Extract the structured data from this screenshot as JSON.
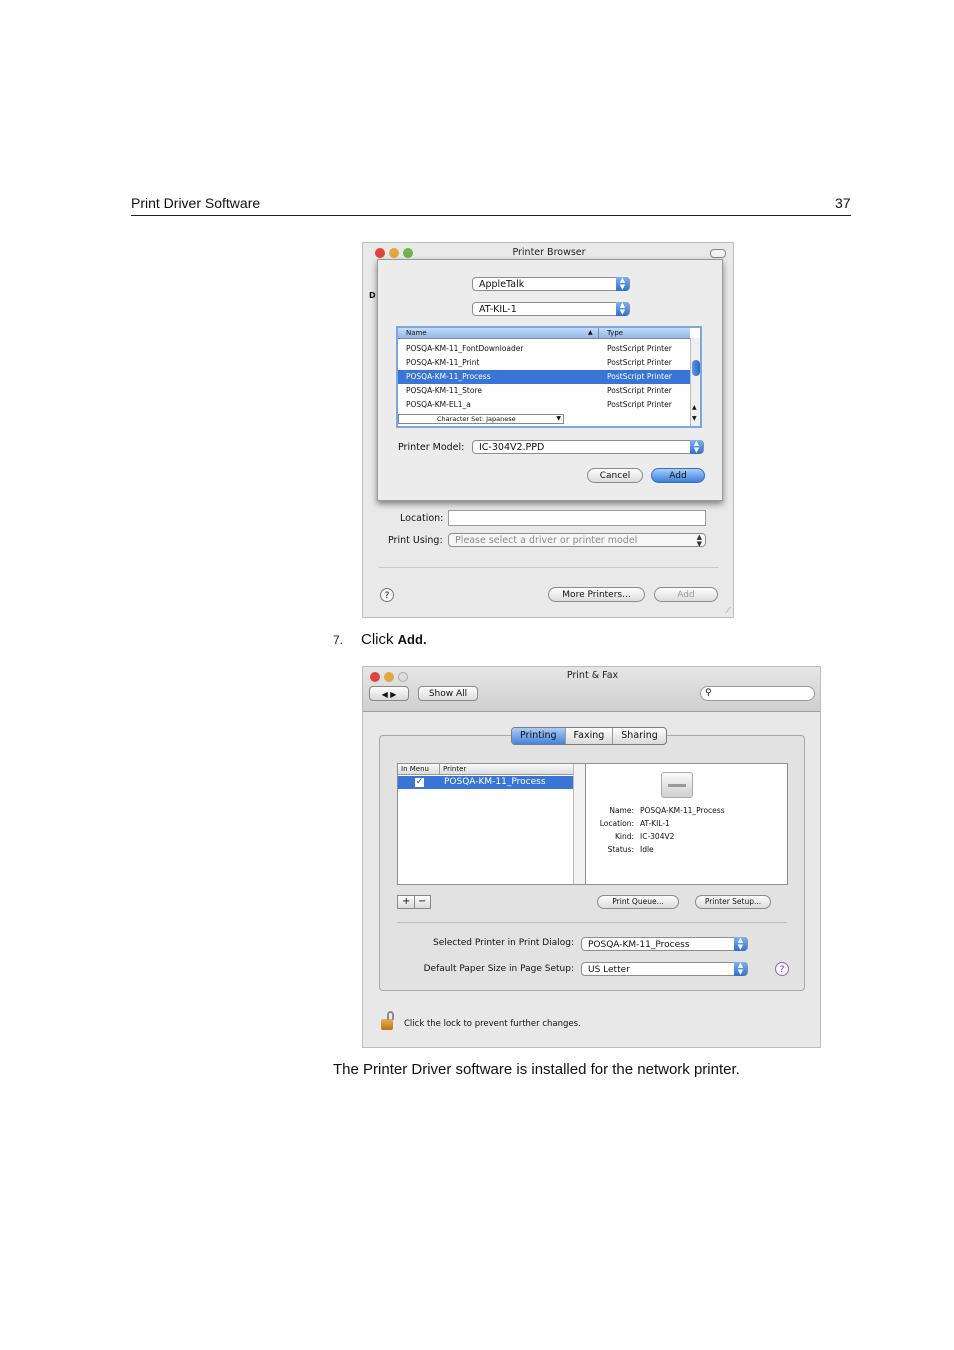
{
  "header": {
    "title": "Print Driver Software",
    "page_number": "37"
  },
  "printer_browser": {
    "window_title": "Printer Browser",
    "connection": "AppleTalk",
    "zone": "AT-KIL-1",
    "columns": {
      "name": "Name",
      "type": "Type"
    },
    "rows": [
      {
        "name": "POSQA-KM-11_FontDownloader",
        "type": "PostScript Printer",
        "selected": false
      },
      {
        "name": "POSQA-KM-11_Print",
        "type": "PostScript Printer",
        "selected": false
      },
      {
        "name": "POSQA-KM-11_Process",
        "type": "PostScript Printer",
        "selected": true
      },
      {
        "name": "POSQA-KM-11_Store",
        "type": "PostScript Printer",
        "selected": false
      },
      {
        "name": "POSQA-KM-EL1_a",
        "type": "PostScript Printer",
        "selected": false
      }
    ],
    "charset": "Character Set: Japanese",
    "printer_model_label": "Printer Model:",
    "printer_model_value": "IC-304V2.PPD",
    "cancel_label": "Cancel",
    "add_label": "Add",
    "side_letter": "D",
    "location_label": "Location:",
    "print_using_label": "Print Using:",
    "print_using_value": "Please select a driver or printer model",
    "more_printers_label": "More Printers...",
    "add_disabled_label": "Add",
    "help_glyph": "?"
  },
  "step": {
    "number": "7.",
    "text": "Click",
    "bold": "Add."
  },
  "print_fax": {
    "window_title": "Print & Fax",
    "show_all_label": "Show All",
    "tabs": [
      "Printing",
      "Faxing",
      "Sharing"
    ],
    "active_tab": "Printing",
    "table_headers": {
      "in_menu": "In Menu",
      "printer": "Printer"
    },
    "printer_row": {
      "checked": true,
      "name": "POSQA-KM-11_Process"
    },
    "details": [
      {
        "key": "Name:",
        "value": "POSQA-KM-11_Process"
      },
      {
        "key": "Location:",
        "value": "AT-KIL-1"
      },
      {
        "key": "Kind:",
        "value": "IC-304V2"
      },
      {
        "key": "Status:",
        "value": "Idle"
      }
    ],
    "add_button": "+",
    "remove_button": "−",
    "print_queue_label": "Print Queue...",
    "printer_setup_label": "Printer Setup...",
    "selected_printer_label": "Selected Printer in Print Dialog:",
    "selected_printer_value": "POSQA-KM-11_Process",
    "paper_size_label": "Default Paper Size in Page Setup:",
    "paper_size_value": "US Letter",
    "lock_text": "Click the lock to prevent further changes.",
    "help_glyph": "?"
  },
  "footer_text": "The Printer Driver software is installed for the network printer."
}
